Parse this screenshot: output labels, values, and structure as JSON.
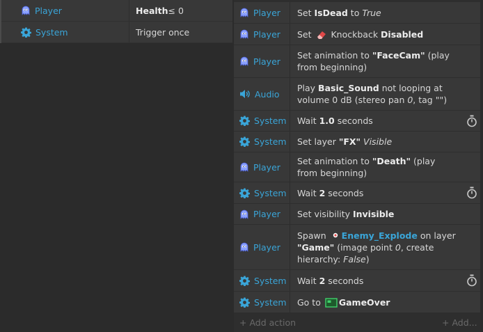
{
  "colors": {
    "object": "#3aa5d8",
    "background": "#2b2b2b",
    "row": "#383838",
    "muted": "#6a6a6a"
  },
  "conditions": [
    {
      "object": "Player",
      "icon": "ghost-icon",
      "text_bold": "Health",
      "text_rest": " ≤ 0"
    },
    {
      "object": "System",
      "icon": "gear-icon",
      "text": "Trigger once"
    }
  ],
  "actions": [
    {
      "object": "Player",
      "icon": "ghost-icon",
      "p1": "Set ",
      "b1": "IsDead",
      "p2": " to ",
      "i1": "True"
    },
    {
      "object": "Player",
      "icon": "ghost-icon",
      "p1": "Set ",
      "p2": " Knockback ",
      "b1": "Disabled",
      "inline_icon": "eraser-icon"
    },
    {
      "object": "Player",
      "icon": "ghost-icon",
      "p1": "Set animation to ",
      "b1": "\"FaceCam\"",
      "p2": " (play from beginning)"
    },
    {
      "object": "Audio",
      "icon": "speaker-icon",
      "p1": "Play ",
      "b1": "Basic_Sound",
      "p2": " not looping at volume 0 dB (stereo pan ",
      "i1": "0",
      "p3": ", tag \"\")"
    },
    {
      "object": "System",
      "icon": "gear-icon",
      "p1": "Wait ",
      "b1": "1.0",
      "p2": " seconds",
      "timer": true
    },
    {
      "object": "System",
      "icon": "gear-icon",
      "p1": "Set layer ",
      "b1": "\"FX\"",
      "p2": " ",
      "i1": "Visible"
    },
    {
      "object": "Player",
      "icon": "ghost-icon",
      "p1": "Set animation to ",
      "b1": "\"Death\"",
      "p2": " (play from beginning)"
    },
    {
      "object": "System",
      "icon": "gear-icon",
      "p1": "Wait ",
      "b1": "2",
      "p2": " seconds",
      "timer": true
    },
    {
      "object": "Player",
      "icon": "ghost-icon",
      "p1": "Set visibility ",
      "b1": "Invisible"
    },
    {
      "object": "Player",
      "icon": "ghost-icon",
      "p1": "Spawn ",
      "lb1": "Enemy_Explode",
      "p2": " on layer ",
      "b1": "\"Game\"",
      "p3": " (image point ",
      "i1": "0",
      "p4": ", create hierarchy: ",
      "i2": "False",
      "p5": ")",
      "inline_icon": "sprite-icon"
    },
    {
      "object": "System",
      "icon": "gear-icon",
      "p1": "Wait ",
      "b1": "2",
      "p2": " seconds",
      "timer": true
    },
    {
      "object": "System",
      "icon": "gear-icon",
      "p1": "Go to ",
      "b1": "GameOver",
      "inline_icon": "layout-icon"
    }
  ],
  "add_action_label": "+ Add action",
  "add_more_label": "+ Add..."
}
